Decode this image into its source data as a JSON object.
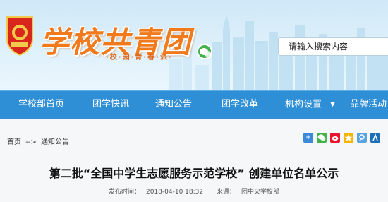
{
  "header": {
    "site_title": "学校共青团",
    "slogan": "·校·园·青·春·派·",
    "search_placeholder": "请输入搜索内容"
  },
  "nav": {
    "items": [
      {
        "label": "学校部首页"
      },
      {
        "label": "团学快讯"
      },
      {
        "label": "通知公告"
      },
      {
        "label": "团学改革"
      },
      {
        "label": "机构设置",
        "caret": "▼"
      },
      {
        "label": "品牌活动"
      }
    ]
  },
  "breadcrumb": {
    "home": "首页",
    "separator": "-->",
    "current": "通知公告"
  },
  "share": {
    "icons": [
      "plus-share-icon",
      "wechat-share-icon",
      "weibo-share-icon",
      "qzone-share-icon",
      "tencent-weibo-icon",
      "renren-share-icon"
    ]
  },
  "article": {
    "title": "第二批“全国中学生志愿服务示范学校” 创建单位名单公示",
    "publish_label": "发布时间：",
    "publish_time": "2018-04-10 18:32",
    "source_label": "来源：",
    "source": "团中央学校部"
  },
  "colors": {
    "nav_bg": "#2e8fd6",
    "title_orange": "#f07a1c",
    "wechat_green": "#43b24b"
  }
}
